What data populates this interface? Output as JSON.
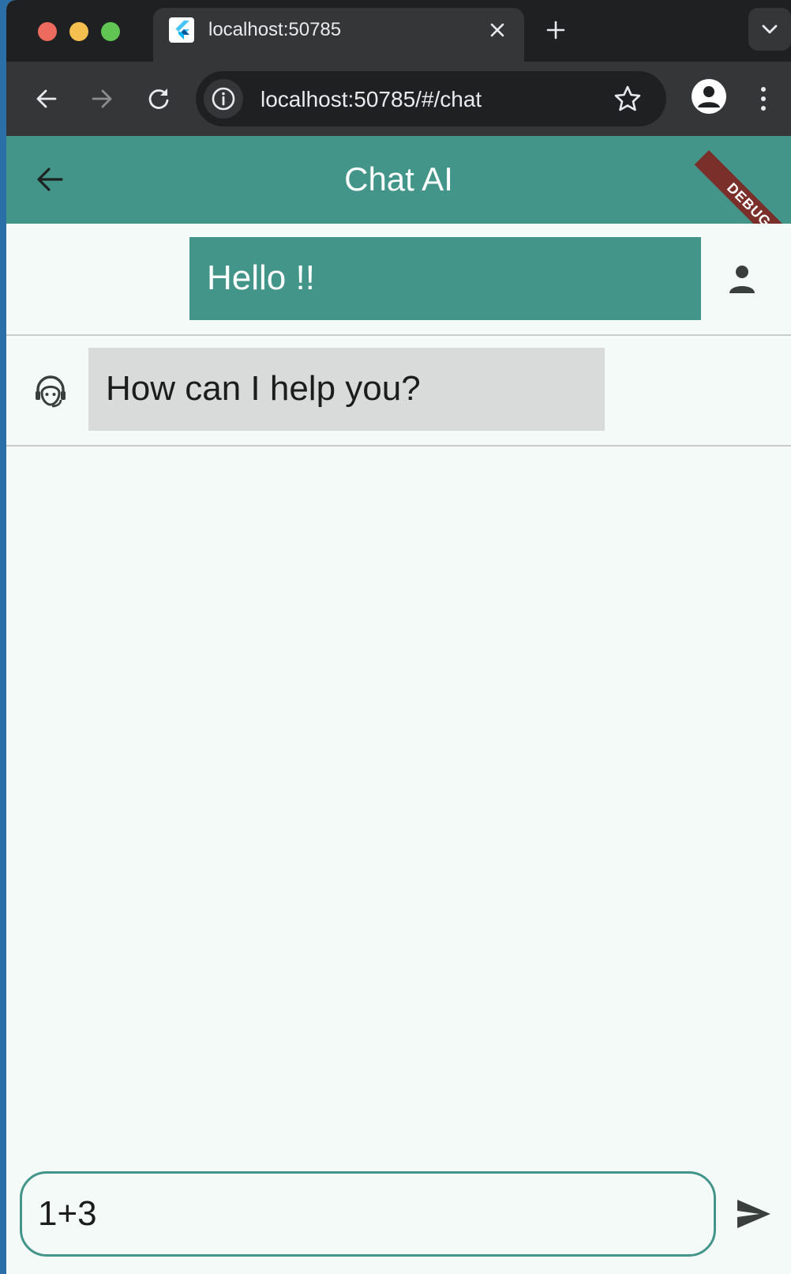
{
  "browser": {
    "tab": {
      "title": "localhost:50785",
      "favicon": "flutter-icon"
    },
    "url": "localhost:50785/#/chat",
    "icons": {
      "back": "back-arrow-icon",
      "forward": "forward-arrow-icon",
      "reload": "reload-icon",
      "site_info": "info-icon",
      "bookmark": "star-icon",
      "profile": "account-icon",
      "menu": "more-vert-icon",
      "new_tab": "plus-icon",
      "tab_close": "close-icon",
      "tab_search": "chevron-down-icon"
    }
  },
  "app": {
    "title": "Chat AI",
    "debug_banner": "DEBUG",
    "colors": {
      "primary": "#43958a",
      "bot_bubble": "#d8dbda",
      "background": "#f4faf8",
      "debug": "#7b2f2a"
    },
    "messages": [
      {
        "sender": "user",
        "text": "Hello !!",
        "icon": "person-icon"
      },
      {
        "sender": "bot",
        "text": "How can I help you?",
        "icon": "support-agent-icon"
      }
    ],
    "input": {
      "value": "1+3"
    },
    "send_icon": "send-icon"
  }
}
